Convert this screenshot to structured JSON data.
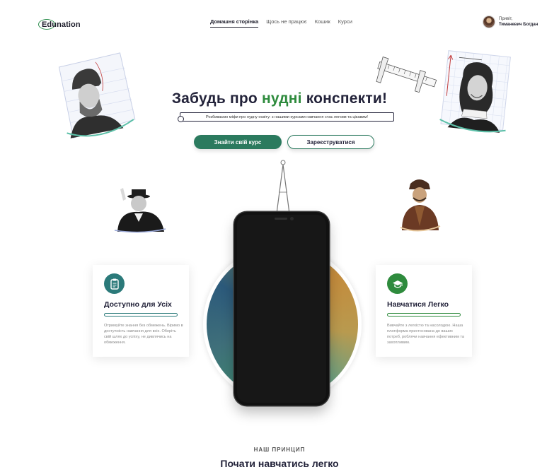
{
  "brand": {
    "logo": "Edunation",
    "accent": "#2e8b3d"
  },
  "nav": {
    "items": [
      {
        "label": "Домашня сторінка",
        "active": true
      },
      {
        "label": "Щось не працює",
        "active": false
      },
      {
        "label": "Кошик",
        "active": false
      },
      {
        "label": "Курси",
        "active": false
      }
    ]
  },
  "user": {
    "greeting": "Привіт,",
    "name": "Тиманевич Богдан"
  },
  "hero": {
    "title_part1": "Забудь про ",
    "title_accent": "нудні",
    "title_part2": " конспекти!",
    "subtitle": "Розбиваємо міфи про нудну освіту: з нашими курсами навчання стає легким та цікавим!",
    "primary_button": "Знайти свій курс",
    "secondary_button": "Зареєструватися"
  },
  "features": [
    {
      "icon": "document-icon",
      "title": "Доступно для Усіх",
      "text": "Отримуйте знання без обмежень. Віримо в доступність навчання для всіх. Оберіть свій шлях до успіху, не дивлячись на обмеження.",
      "color": "#2b7a7a"
    },
    {
      "icon": "graduation-cap-icon",
      "title": "Навчатися Легко",
      "text": "Вивчайте з легкістю та насолодою. Наша платформа пристосована до ваших потреб, роблячи навчання ефективним та захопливим.",
      "color": "#2e8b3d"
    }
  ],
  "section": {
    "kicker": "НАШ ПРИНЦИП",
    "title": "Почати навчатись легко"
  }
}
